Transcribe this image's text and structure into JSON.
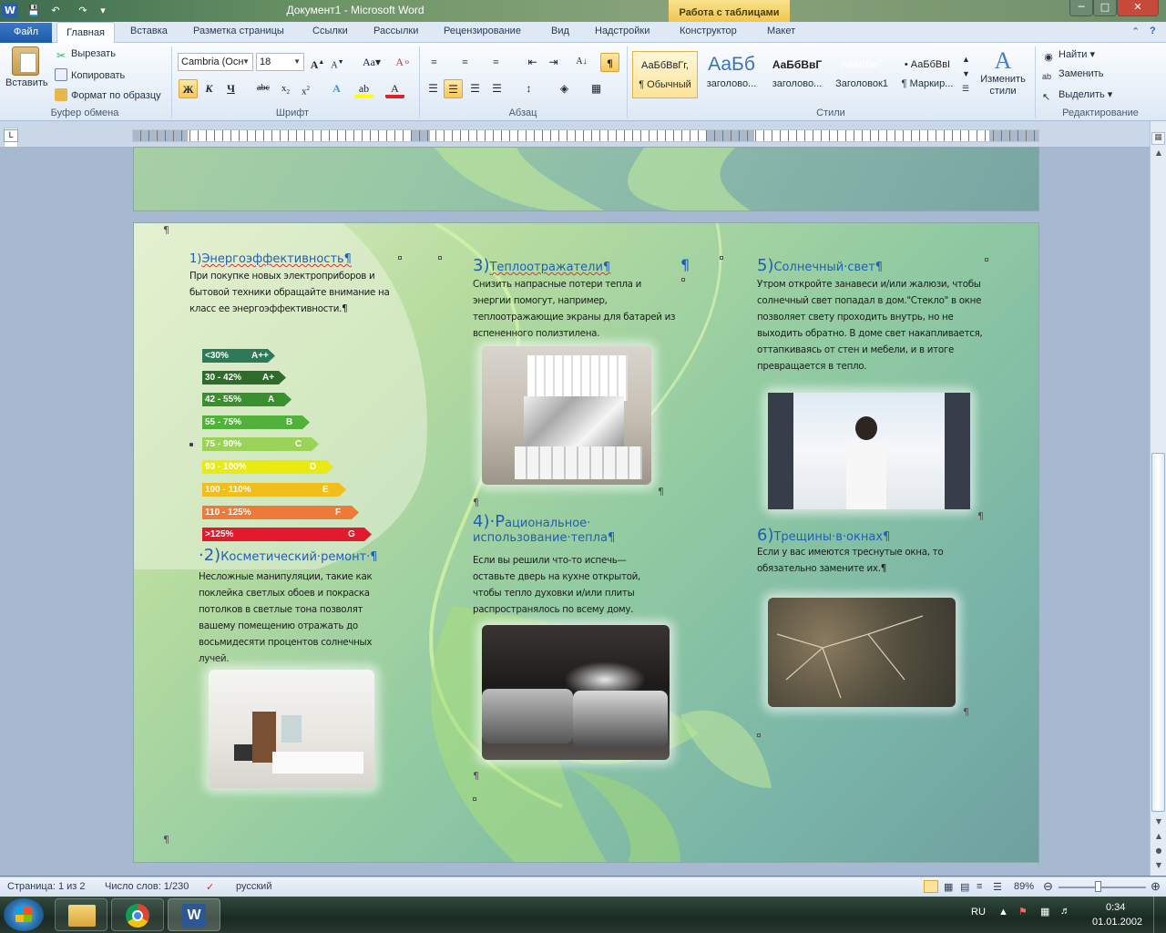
{
  "window": {
    "title": "Документ1  -  Microsoft Word",
    "context_tools_label": "Работа с таблицами"
  },
  "tabs": {
    "file": "Файл",
    "items": [
      "Главная",
      "Вставка",
      "Разметка страницы",
      "Ссылки",
      "Рассылки",
      "Рецензирование",
      "Вид",
      "Надстройки",
      "Конструктор",
      "Макет"
    ]
  },
  "ribbon": {
    "clipboard": {
      "paste": "Вставить",
      "cut": "Вырезать",
      "copy": "Копировать",
      "format_painter": "Формат по образцу",
      "label": "Буфер обмена"
    },
    "font": {
      "name": "Cambria (Осн",
      "size": "18",
      "label": "Шрифт",
      "bold": "Ж",
      "italic": "К",
      "underline": "Ч",
      "strike": "abc"
    },
    "paragraph": {
      "label": "Абзац"
    },
    "styles": {
      "label": "Стили",
      "items": [
        {
          "preview": "АаБбВвГг,",
          "name": "¶ Обычный"
        },
        {
          "preview": "АаБб",
          "name": "заголово..."
        },
        {
          "preview": "АаБбВвГ",
          "name": "заголово..."
        },
        {
          "preview": "АаБбВвГ",
          "name": "Заголовок1"
        },
        {
          "preview": "• АаБбВвI",
          "name": "¶ Маркир..."
        }
      ],
      "change_styles": "Изменить стили"
    },
    "editing": {
      "find": "Найти",
      "replace": "Заменить",
      "select": "Выделить",
      "label": "Редактирование"
    }
  },
  "document": {
    "sections": [
      {
        "num": "1)",
        "title": "Энергоэффективность¶",
        "text": "При покупке новых электроприборов и бытовой техники обращайте внимание на класс ее энергоэффективности.¶"
      },
      {
        "num": "·2)",
        "title": "Косметический·ремонт·¶",
        "text": "Несложные манипуляции, такие как поклейка светлых обоев и покраска потолков в светлые тона позволят вашему помещению отражать до восьмидесяти процентов солнечных лучей."
      },
      {
        "num": "3)",
        "title": "Теплоотражатели¶",
        "text": "Снизить напрасные потери тепла и энергии помогут, например, теплоотражающие экраны для батарей из вспененного полизтилена."
      },
      {
        "num": "4)·Р",
        "title": "ациональное· использование·тепла¶",
        "text": "Если вы решили что-то испечь— оставьте дверь на кухне открытой, чтобы тепло духовки и/или плиты распространялось по всему дому."
      },
      {
        "num": "5)",
        "title": "Солнечный·свет¶",
        "text": "Утром откройте занавеси и/или жалюзи, чтобы солнечный свет попадал в дом.\"Стекло\" в окне позволяет свету проходить внутрь, но не выходить обратно. В доме свет накапливается, оттапкиваясь от стен и мебели, и в итоге превращается в тепло."
      },
      {
        "num": "6)",
        "title": "Трещины·в·окнах¶",
        "text": "Если у вас имеются треснутые окна, то обязательно замените их.¶"
      }
    ],
    "energy_classes": [
      {
        "range": "<30%",
        "cls": "A++",
        "color": "#2d7a5b"
      },
      {
        "range": "30 - 42%",
        "cls": "A+",
        "color": "#2f6b2c"
      },
      {
        "range": "42 - 55%",
        "cls": "A",
        "color": "#3a8f2e"
      },
      {
        "range": "55 - 75%",
        "cls": "B",
        "color": "#52b13a"
      },
      {
        "range": "75 - 90%",
        "cls": "C",
        "color": "#9ad25a"
      },
      {
        "range": "90 - 100%",
        "cls": "D",
        "color": "#e8ea12"
      },
      {
        "range": "100 - 110%",
        "cls": "E",
        "color": "#f1be1b"
      },
      {
        "range": "110 - 125%",
        "cls": "F",
        "color": "#ee7a3a"
      },
      {
        "range": ">125%",
        "cls": "G",
        "color": "#e11b2d"
      }
    ]
  },
  "status": {
    "page": "Страница: 1 из 2",
    "words": "Число слов: 1/230",
    "lang": "русский",
    "zoom": "89%"
  },
  "taskbar": {
    "lang": "RU",
    "time": "0:34",
    "date": "01.01.2002"
  }
}
